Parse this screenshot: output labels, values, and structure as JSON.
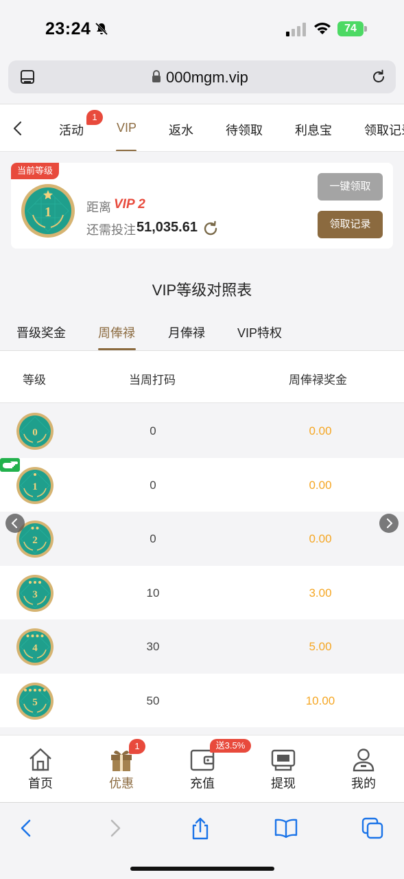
{
  "status_bar": {
    "time": "23:24",
    "battery": "74"
  },
  "browser": {
    "url": "000mgm.vip"
  },
  "top_nav": {
    "tabs": [
      "活动",
      "VIP",
      "返水",
      "待领取",
      "利息宝",
      "领取记录"
    ],
    "active_index": 1,
    "activity_badge": "1"
  },
  "vip_card": {
    "tag": "当前等级",
    "current_level": "1",
    "distance_label": "距离",
    "next_level": "VIP 2",
    "need_label": "还需投注",
    "need_value": "51,035.61",
    "claim_all_label": "一键领取",
    "claim_record_label": "领取记录"
  },
  "table_title": "VIP等级对照表",
  "sub_tabs": [
    "晋级奖金",
    "周俸禄",
    "月俸禄",
    "VIP特权"
  ],
  "sub_tab_active_index": 1,
  "table": {
    "headers": [
      "等级",
      "当周打码",
      "周俸禄奖金"
    ],
    "rows": [
      {
        "level": "0",
        "code": "0",
        "bonus": "0.00"
      },
      {
        "level": "1",
        "code": "0",
        "bonus": "0.00"
      },
      {
        "level": "2",
        "code": "0",
        "bonus": "0.00"
      },
      {
        "level": "3",
        "code": "10",
        "bonus": "3.00"
      },
      {
        "level": "4",
        "code": "30",
        "bonus": "5.00"
      },
      {
        "level": "5",
        "code": "50",
        "bonus": "10.00"
      }
    ],
    "current_row_index": 1
  },
  "app_nav": {
    "items": [
      "首页",
      "优惠",
      "充值",
      "提现",
      "我的"
    ],
    "active_index": 1,
    "gift_badge": "1",
    "recharge_badge": "送3.5%"
  },
  "colors": {
    "accent": "#8b6a3f",
    "danger": "#e84a3c",
    "bonus": "#f5a623",
    "badge_green": "#1f9f8c"
  }
}
